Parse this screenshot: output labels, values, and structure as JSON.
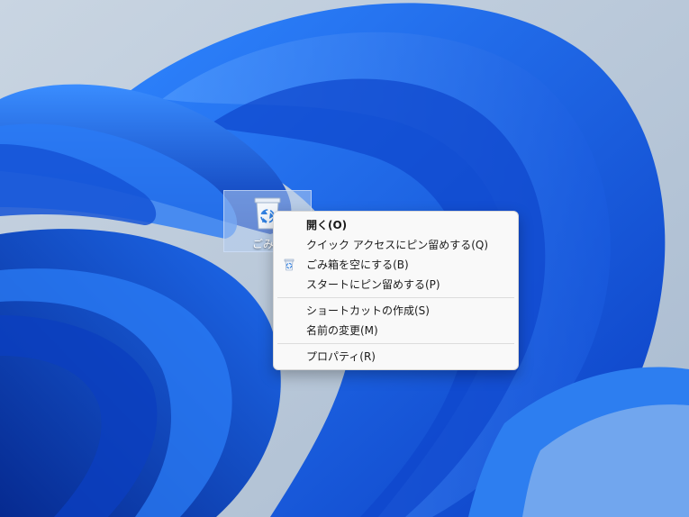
{
  "desktop": {
    "recycle_bin_label": "ごみ箱"
  },
  "context_menu": {
    "items": [
      {
        "label": "開く(O)",
        "bold": true,
        "icon": ""
      },
      {
        "label": "クイック アクセスにピン留めする(Q)",
        "bold": false,
        "icon": ""
      },
      {
        "label": "ごみ箱を空にする(B)",
        "bold": false,
        "icon": "recycle-bin-icon"
      },
      {
        "label": "スタートにピン留めする(P)",
        "bold": false,
        "icon": ""
      },
      {
        "label": "ショートカットの作成(S)",
        "bold": false,
        "icon": ""
      },
      {
        "label": "名前の変更(M)",
        "bold": false,
        "icon": ""
      },
      {
        "label": "プロパティ(R)",
        "bold": false,
        "icon": ""
      }
    ]
  },
  "colors": {
    "wallpaper_sky": "#aebfd2",
    "wallpaper_blue": "#1a5ce0",
    "menu_background": "#f9f9f9",
    "menu_text": "#1a1a1a"
  }
}
